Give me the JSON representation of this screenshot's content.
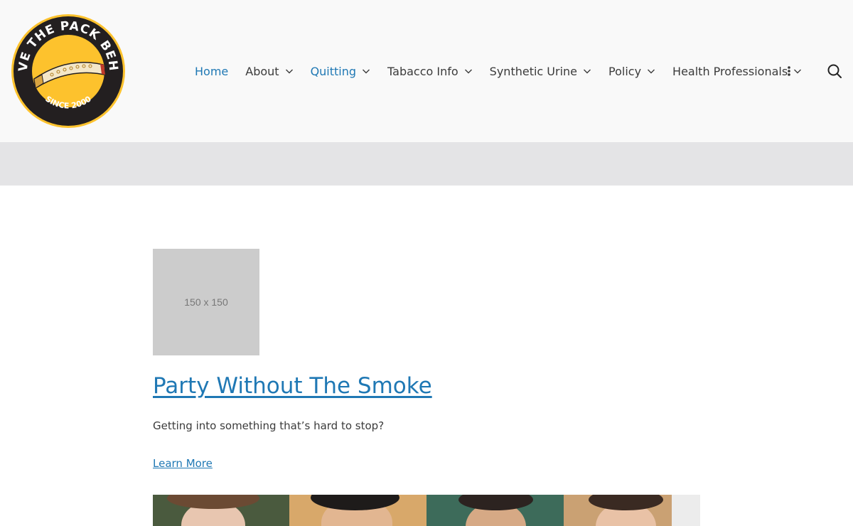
{
  "logo": {
    "top_text": "LEAVE THE PACK BEHIND",
    "bottom_text": "SINCE 2000"
  },
  "nav": {
    "items": [
      {
        "label": "Home",
        "has_dropdown": false,
        "active": true
      },
      {
        "label": "About",
        "has_dropdown": true,
        "active": false
      },
      {
        "label": "Quitting",
        "has_dropdown": true,
        "active": true
      },
      {
        "label": "Tabacco Info",
        "has_dropdown": true,
        "active": false
      },
      {
        "label": "Synthetic Urine",
        "has_dropdown": true,
        "active": false
      },
      {
        "label": "Policy",
        "has_dropdown": true,
        "active": false
      },
      {
        "label": "Health Professionals",
        "has_dropdown": true,
        "active": false
      }
    ],
    "more_icon": "vertical-dots-icon",
    "search_icon": "search-icon"
  },
  "post": {
    "thumbnail_text": "150 x 150",
    "title": "Party Without The Smoke",
    "excerpt": "Getting into something that’s hard to stop?",
    "link_label": "Learn More"
  },
  "colors": {
    "link": "#1f78b4",
    "header_bg": "#f9f9f9",
    "band_bg": "#e4e4e6",
    "logo_yellow": "#fdc22d",
    "logo_dark": "#231f20"
  }
}
